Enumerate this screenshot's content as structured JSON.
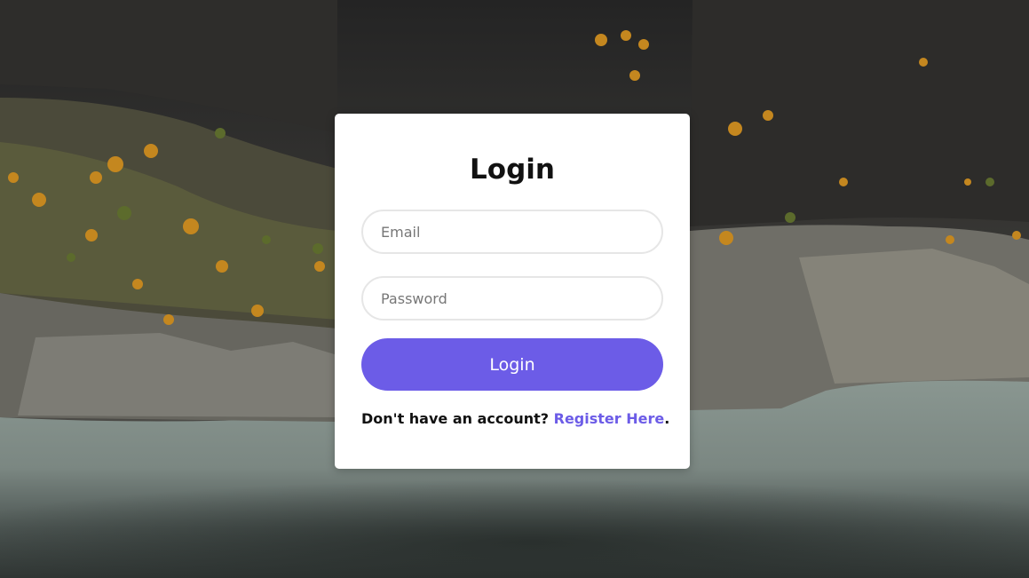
{
  "background": {
    "description_icon": "mountain-lake-photo-icon",
    "colors": {
      "rock_dark": "#2a2a2a",
      "rock_mid": "#4b4a47",
      "rock_light": "#7b7a75",
      "foliage_orange": "#c4871f",
      "foliage_green": "#5c6b2c",
      "water": "#7c8a84"
    }
  },
  "login_form": {
    "title": "Login",
    "email_placeholder": "Email",
    "email_value": "",
    "password_placeholder": "Password",
    "password_value": "",
    "submit_label": "Login",
    "register_prompt": "Don't have an account? ",
    "register_link": "Register Here",
    "register_suffix": "."
  },
  "colors": {
    "accent": "#6c5ce7",
    "card_bg": "#ffffff",
    "text": "#111111",
    "input_border": "#e6e6e6"
  }
}
